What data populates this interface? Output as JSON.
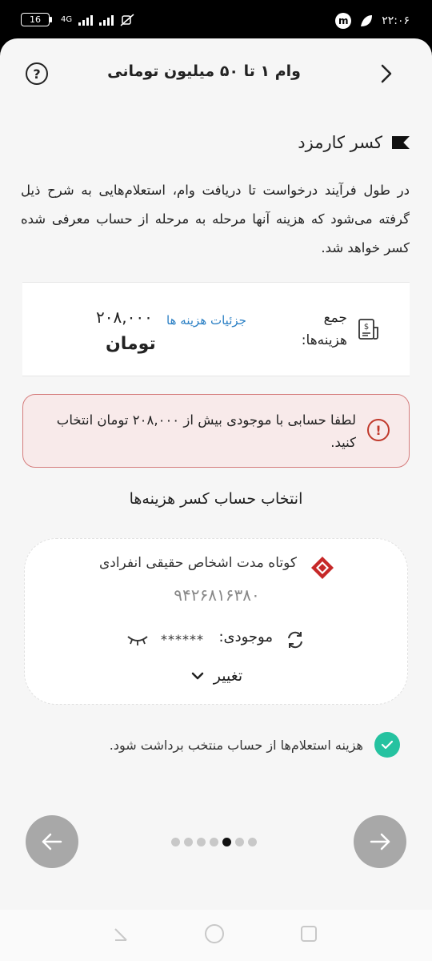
{
  "status_bar": {
    "battery": "16",
    "network": "4G",
    "time": "۲۲:۰۶"
  },
  "header": {
    "title": "وام ۱ تا ۵۰ میلیون تومانی",
    "help_icon": "?"
  },
  "section": {
    "title": "کسر کارمزد",
    "description": "در طول فرآیند درخواست تا دریافت وام، استعلام‌هایی به شرح ذیل گرفته می‌شود که هزینه آنها مرحله به مرحله از حساب معرفی شده کسر خواهد شد."
  },
  "fees": {
    "label": "جمع هزینه‌ها:",
    "details_link": "جزئیات هزینه ها",
    "amount": "۲۰۸,۰۰۰",
    "unit": "تومان"
  },
  "alert": {
    "text": "لطفا حسابی با موجودی بیش از ۲۰۸,۰۰۰ تومان انتخاب کنید.",
    "icon": "!"
  },
  "account_select": {
    "title": "انتخاب حساب کسر هزینه‌ها",
    "account_name": "کوتاه مدت اشخاص حقیقی انفرادی",
    "account_number": "۹۴۲۶۸۱۶۳۸۰",
    "balance_label": "موجودی:",
    "balance_value": "******",
    "change_label": "تغییر"
  },
  "consent": {
    "text": "هزینه استعلام‌ها از حساب منتخب برداشت شود."
  },
  "pagination": {
    "total": 7,
    "active": 5
  },
  "colors": {
    "accent_link": "#2a7fc4",
    "alert_border": "#d57d7d",
    "check": "#25c2a0",
    "nav_button": "#a8a8a8"
  }
}
